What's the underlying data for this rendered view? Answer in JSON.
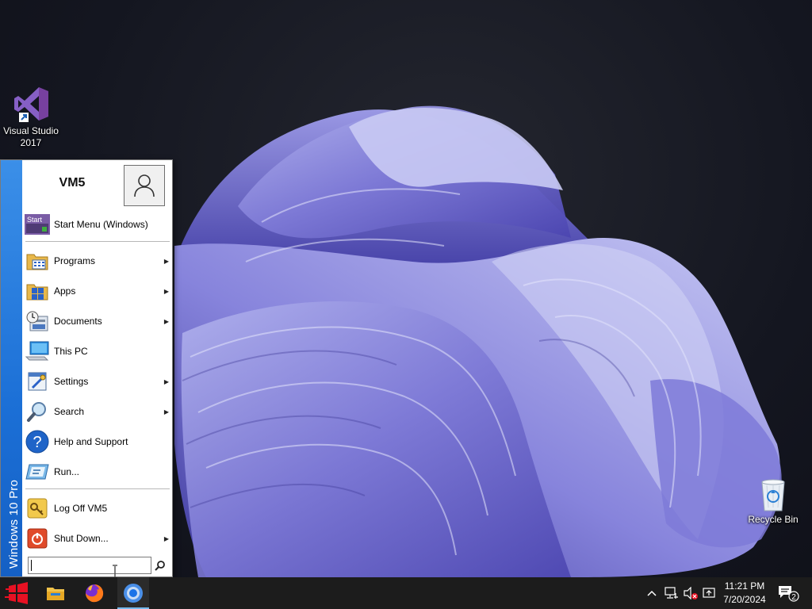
{
  "desktop": {
    "icons": [
      {
        "label_line1": "Visual Studio",
        "label_line2": "2017",
        "icon": "visual-studio-icon"
      },
      {
        "label": "Recycle Bin",
        "icon": "recycle-bin-icon"
      }
    ]
  },
  "start_menu": {
    "edition": "Windows 10 Pro",
    "user_name": "VM5",
    "pinned": {
      "label": "Start Menu (Windows)",
      "icon_text": "Start"
    },
    "items": [
      {
        "label": "Programs",
        "icon": "programs-icon",
        "submenu": true
      },
      {
        "label": "Apps",
        "icon": "apps-icon",
        "submenu": true
      },
      {
        "label": "Documents",
        "icon": "documents-icon",
        "submenu": true
      },
      {
        "label": "This PC",
        "icon": "this-pc-icon",
        "submenu": false
      },
      {
        "label": "Settings",
        "icon": "settings-icon",
        "submenu": true
      },
      {
        "label": "Search",
        "icon": "search-icon",
        "submenu": true
      },
      {
        "label": "Help and Support",
        "icon": "help-icon",
        "submenu": false
      },
      {
        "label": "Run...",
        "icon": "run-icon",
        "submenu": false
      }
    ],
    "logoff": {
      "label": "Log Off VM5",
      "icon": "key-icon"
    },
    "shutdown": {
      "label": "Shut Down...",
      "icon": "power-icon",
      "submenu": true
    },
    "search": {
      "value": "",
      "placeholder": ""
    }
  },
  "taskbar": {
    "pinned_apps": [
      "file-explorer-icon",
      "firefox-icon",
      "chrome-icon"
    ],
    "tray": {
      "time": "11:21 PM",
      "date": "7/20/2024",
      "notification_count": "2"
    }
  },
  "colors": {
    "edition_bar": "#1b6fd6",
    "taskbar": "#1c1c1c",
    "start_button": "#e81123",
    "wallpaper_petal": "#6b66c9"
  }
}
